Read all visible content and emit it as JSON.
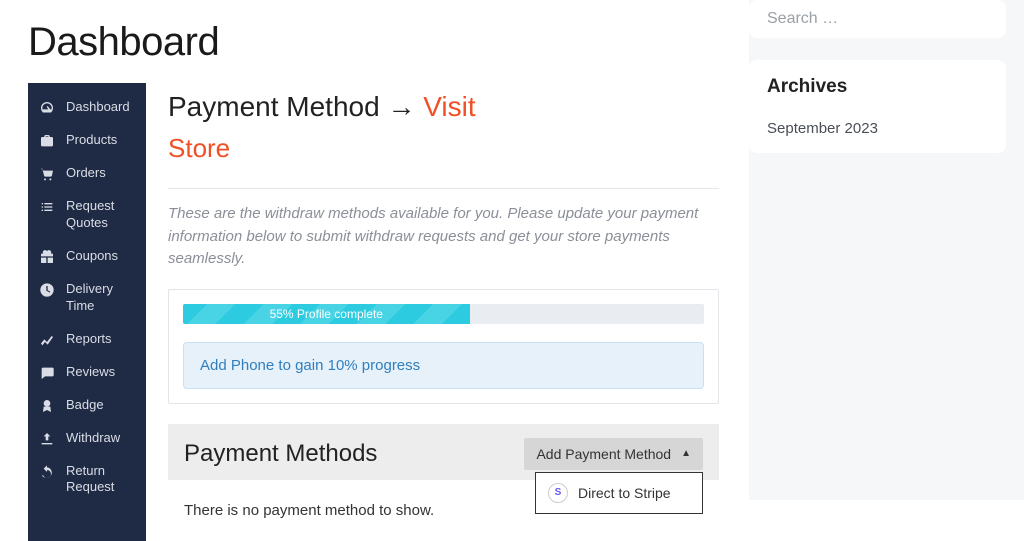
{
  "page_title": "Dashboard",
  "sidebar": {
    "items": [
      {
        "label": "Dashboard",
        "icon": "gauge-icon"
      },
      {
        "label": "Products",
        "icon": "briefcase-icon"
      },
      {
        "label": "Orders",
        "icon": "cart-icon"
      },
      {
        "label": "Request Quotes",
        "icon": "list-icon"
      },
      {
        "label": "Coupons",
        "icon": "gift-icon"
      },
      {
        "label": "Delivery Time",
        "icon": "clock-icon"
      },
      {
        "label": "Reports",
        "icon": "chart-icon"
      },
      {
        "label": "Reviews",
        "icon": "chat-icon"
      },
      {
        "label": "Badge",
        "icon": "badge-icon"
      },
      {
        "label": "Withdraw",
        "icon": "upload-icon"
      },
      {
        "label": "Return Request",
        "icon": "undo-icon"
      }
    ]
  },
  "content": {
    "heading": "Payment Method",
    "arrow": "→",
    "visit_link": "Visit",
    "visit_store": "Store",
    "description": "These are the withdraw methods available for you. Please update your payment information below to submit withdraw requests and get your store payments seamlessly.",
    "progress": {
      "percent": 55,
      "label": "55% Profile complete"
    },
    "alert": "Add Phone to gain 10% progress",
    "pm_title": "Payment Methods",
    "add_pm_label": "Add Payment Method",
    "dropdown": {
      "options": [
        {
          "label": "Direct to Stripe"
        }
      ]
    },
    "empty_msg": "There is no payment method to show."
  },
  "right": {
    "search_placeholder": "Search …",
    "archives_title": "Archives",
    "archives": [
      "September 2023"
    ]
  }
}
